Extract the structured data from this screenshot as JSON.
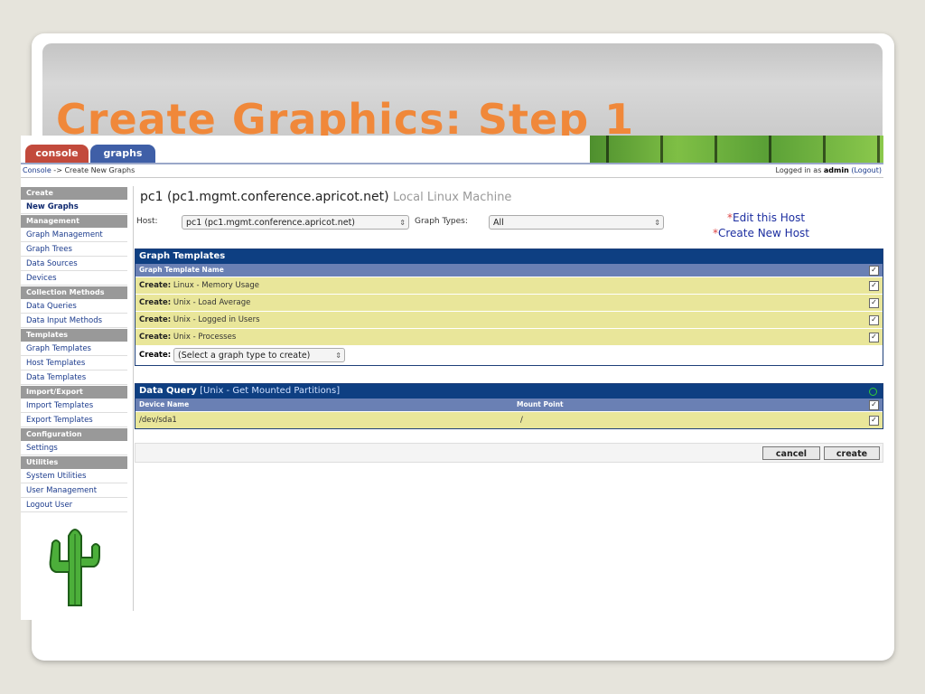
{
  "slide": {
    "title": "Create Graphics: Step 1"
  },
  "tabs": {
    "console": "console",
    "graphs": "graphs"
  },
  "navbar": {
    "breadcrumb_link": "Console",
    "breadcrumb_rest": " -> Create New Graphs",
    "login_prefix": "Logged in as ",
    "login_user": "admin",
    "logout": "(Logout)"
  },
  "sidebar": {
    "sections": [
      {
        "header": "Create",
        "items": [
          {
            "label": "New Graphs",
            "selected": true
          }
        ]
      },
      {
        "header": "Management",
        "items": [
          {
            "label": "Graph Management"
          },
          {
            "label": "Graph Trees"
          },
          {
            "label": "Data Sources"
          },
          {
            "label": "Devices"
          }
        ]
      },
      {
        "header": "Collection Methods",
        "items": [
          {
            "label": "Data Queries"
          },
          {
            "label": "Data Input Methods"
          }
        ]
      },
      {
        "header": "Templates",
        "items": [
          {
            "label": "Graph Templates"
          },
          {
            "label": "Host Templates"
          },
          {
            "label": "Data Templates"
          }
        ]
      },
      {
        "header": "Import/Export",
        "items": [
          {
            "label": "Import Templates"
          },
          {
            "label": "Export Templates"
          }
        ]
      },
      {
        "header": "Configuration",
        "items": [
          {
            "label": "Settings"
          }
        ]
      },
      {
        "header": "Utilities",
        "items": [
          {
            "label": "System Utilities"
          },
          {
            "label": "User Management"
          },
          {
            "label": "Logout User"
          }
        ]
      }
    ]
  },
  "main": {
    "host_name": "pc1 (pc1.mgmt.conference.apricot.net)",
    "host_desc": "Local Linux Machine",
    "host_label": "Host:",
    "host_value": "pc1 (pc1.mgmt.conference.apricot.net)",
    "graph_types_label": "Graph Types:",
    "graph_types_value": "All",
    "edit_host": "Edit this Host",
    "create_host": "Create New Host",
    "star": "*"
  },
  "graph_templates": {
    "title": "Graph Templates",
    "col_header": "Graph Template Name",
    "rows": [
      {
        "prefix": "Create:",
        "name": " Linux - Memory Usage"
      },
      {
        "prefix": "Create:",
        "name": " Unix - Load Average"
      },
      {
        "prefix": "Create:",
        "name": " Unix - Logged in Users"
      },
      {
        "prefix": "Create:",
        "name": " Unix - Processes"
      }
    ],
    "create_label": "Create:",
    "create_select": "(Select a graph type to create)"
  },
  "data_query": {
    "title": "Data Query",
    "subtitle": " [Unix - Get Mounted Partitions]",
    "col_device": "Device Name",
    "col_mount": "Mount Point",
    "rows": [
      {
        "device": "/dev/sda1",
        "mount": "/"
      }
    ]
  },
  "buttons": {
    "cancel": "cancel",
    "create": "create"
  },
  "colors": {
    "title": "#f0883a",
    "panel_header": "#0e3f82",
    "row": "#e9e69a",
    "tab_console": "#c24a3c",
    "tab_graphs": "#3f5fa7"
  }
}
